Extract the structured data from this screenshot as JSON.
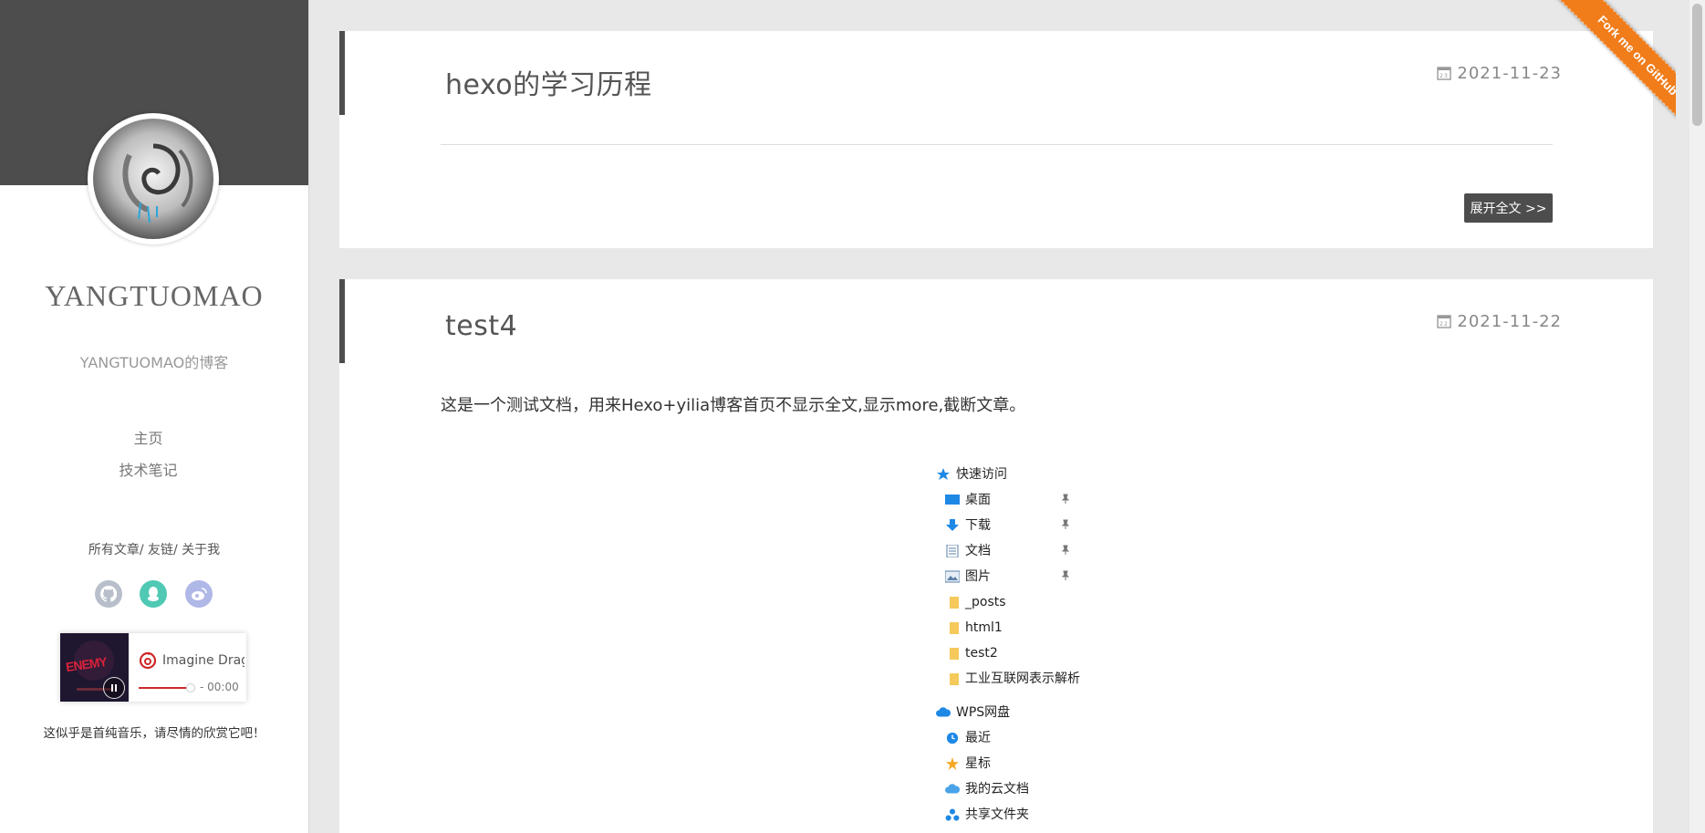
{
  "sidebar": {
    "blog_title": "YANGTUOMAO",
    "subtitle": "YANGTUOMAO的博客",
    "nav": [
      {
        "label": "主页"
      },
      {
        "label": "技术笔记"
      }
    ],
    "links": {
      "all_posts": "所有文章/",
      "friends": " 友链/",
      "about": " 关于我"
    },
    "social_icons": [
      "github-icon",
      "qq-icon",
      "weibo-icon"
    ],
    "player": {
      "cover_text": "ENEMY",
      "song": "Imagine Dragons",
      "time": "- 00:00",
      "progress": 0.82
    },
    "music_note": "这似乎是首纯音乐，请尽情的欣赏它吧！"
  },
  "posts": [
    {
      "title": "hexo的学习历程",
      "date": "2021-11-23",
      "readmore": "展开全文 >>"
    },
    {
      "title": "test4",
      "date": "2021-11-22",
      "excerpt": "这是一个测试文档，用来Hexo+yilia博客首页不显示全文,显示more,截断文章。",
      "explorer": {
        "quick_access": "快速访问",
        "pinned": [
          {
            "label": "桌面",
            "icon": "desktop-icon"
          },
          {
            "label": "下载",
            "icon": "download-icon"
          },
          {
            "label": "文档",
            "icon": "document-icon"
          },
          {
            "label": "图片",
            "icon": "picture-icon"
          }
        ],
        "folders": [
          "_posts",
          "html1",
          "test2",
          "工业互联网表示解析"
        ],
        "wps": "WPS网盘",
        "wps_items": [
          {
            "label": "最近",
            "icon": "clock-icon"
          },
          {
            "label": "星标",
            "icon": "star-icon"
          },
          {
            "label": "我的云文档",
            "icon": "cloud-icon"
          },
          {
            "label": "共享文件夹",
            "icon": "shared-folder-icon"
          }
        ]
      }
    }
  ],
  "ribbon": "Fork me on GitHub",
  "colors": {
    "accent": "#4d4d4d",
    "ribbon": "#f07c1a",
    "netease_red": "#cd2929"
  }
}
